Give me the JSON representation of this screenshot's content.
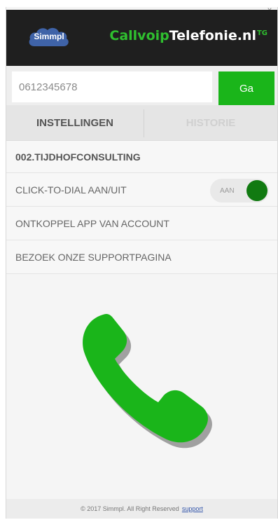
{
  "window": {
    "close_symbol": "x"
  },
  "header": {
    "logo_label": "Simmpl",
    "brand_part1": "Callvoip",
    "brand_part2": "Telefonie.nl",
    "brand_superscript": "TG",
    "colors": {
      "background": "#1f1f1f",
      "accent": "#2fbf2f"
    }
  },
  "search": {
    "value": "0612345678",
    "go_label": "Ga"
  },
  "tabs": [
    {
      "label": "INSTELLINGEN",
      "active": true
    },
    {
      "label": "HISTORIE",
      "active": false
    }
  ],
  "account": {
    "name": "002.TIJDHOFCONSULTING"
  },
  "menu": {
    "click_to_dial": "CLICK-TO-DIAL AAN/UIT",
    "toggle_label": "AAN",
    "toggle_on": true,
    "disconnect": "ONTKOPPEL APP VAN ACCOUNT",
    "support_page": "BEZOEK ONZE SUPPORTPAGINA"
  },
  "illustration": {
    "icon": "phone-handset-icon",
    "color": "#1ab51a"
  },
  "footer": {
    "copyright": "© 2017 Simmpl. All Right Reserved",
    "support_link": "support"
  }
}
